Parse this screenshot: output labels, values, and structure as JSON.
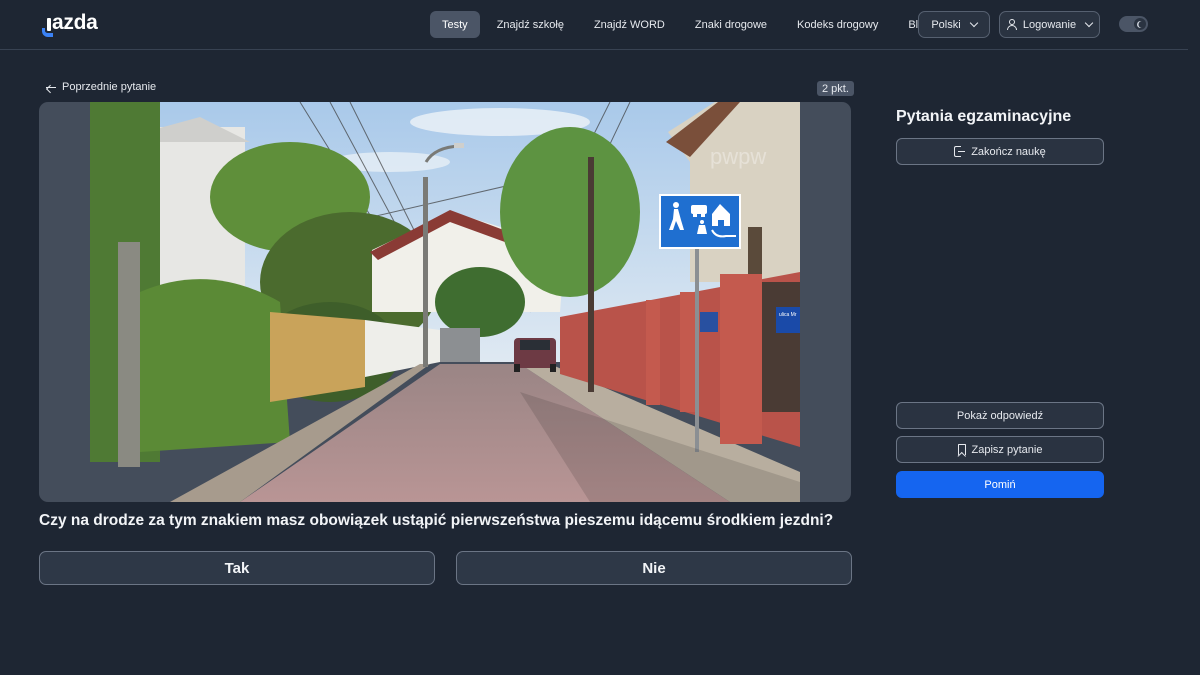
{
  "header": {
    "logo_text": "azda",
    "nav": [
      {
        "label": "Testy",
        "active": true
      },
      {
        "label": "Znajdź szkołę",
        "active": false
      },
      {
        "label": "Znajdź WORD",
        "active": false
      },
      {
        "label": "Znaki drogowe",
        "active": false
      },
      {
        "label": "Kodeks drogowy",
        "active": false
      },
      {
        "label": "Blog",
        "active": false
      }
    ],
    "language_label": "Polski",
    "login_label": "Logowanie",
    "theme_toggle_icon": "moon-icon"
  },
  "question_view": {
    "prev_label": "Poprzednie pytanie",
    "points_label": "2 pkt.",
    "image_text": {
      "watermark": "pwpw",
      "street_plate": "ulica Mr"
    },
    "question_text": "Czy na drodze za tym znakiem masz obowiązek ustąpić pierwszeństwa pieszemu idącemu środkiem jezdni?",
    "answers": [
      {
        "label": "Tak"
      },
      {
        "label": "Nie"
      }
    ]
  },
  "side_panel": {
    "title": "Pytania egzaminacyjne",
    "end_label": "Zakończ naukę",
    "show_answer_label": "Pokaż odpowiedź",
    "save_label": "Zapisz pytanie",
    "skip_label": "Pomiń"
  },
  "colors": {
    "background": "#1e2633",
    "primary": "#1565f0",
    "logo_accent": "#3b82f6",
    "sign_blue": "#1f6fd0"
  }
}
